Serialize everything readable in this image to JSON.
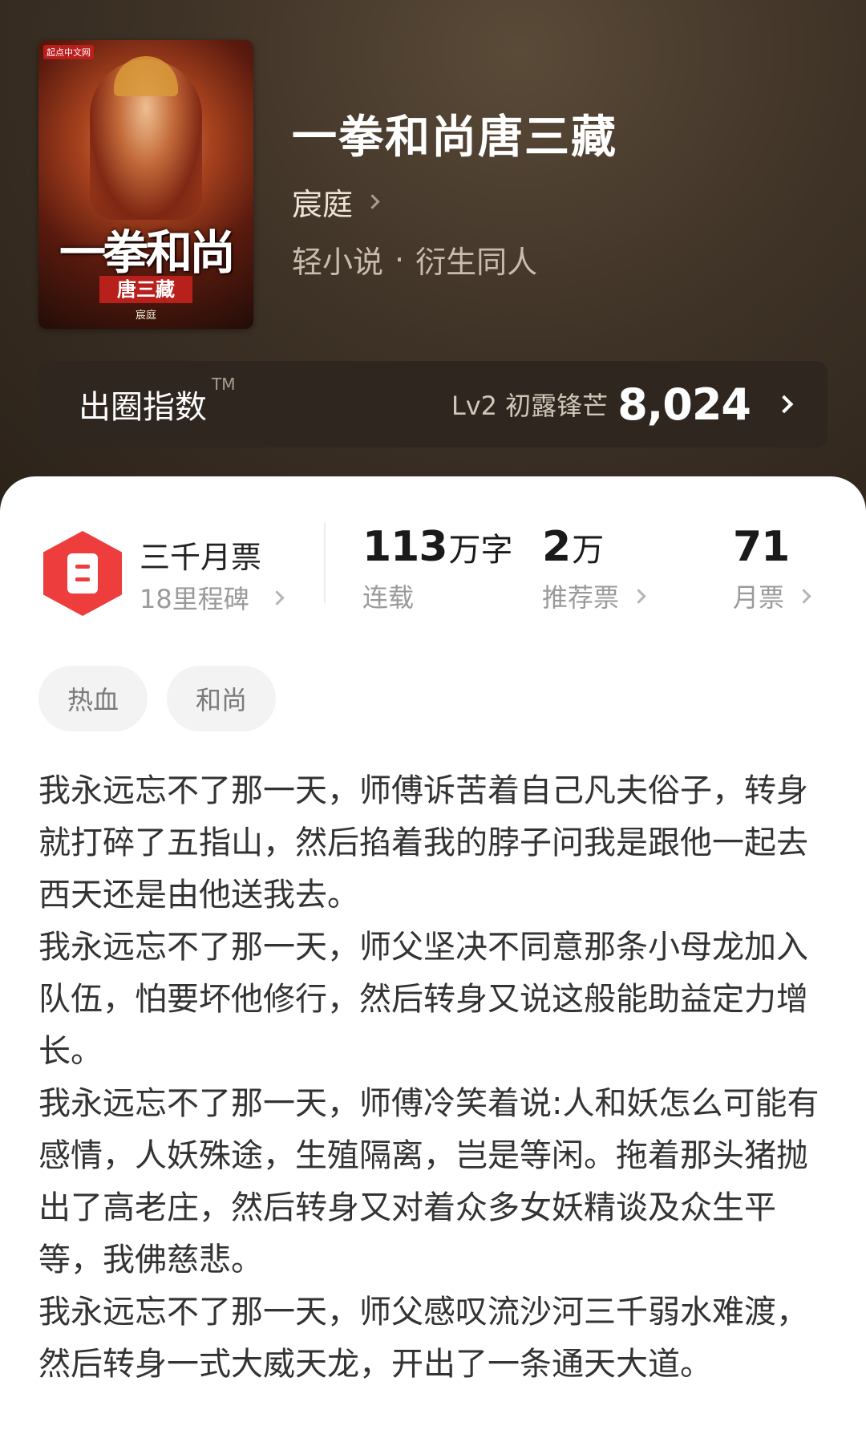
{
  "book": {
    "title": "一拳和尚唐三藏",
    "author": "宸庭",
    "category": "轻小说",
    "dot": "·",
    "subcategory": "衍生同人"
  },
  "cover": {
    "publisher": "起点中文网",
    "title_art": "一拳和尚",
    "subtitle_art": "唐三藏",
    "author_art": "宸庭"
  },
  "index": {
    "label": "出圈指数",
    "tm": "TM",
    "level": "Lv2 初露锋芒",
    "score": "8,024"
  },
  "ranking": {
    "title": "三千月票",
    "milestone": "18里程碑"
  },
  "stats": {
    "words": {
      "num": "113",
      "unit": "万字",
      "label": "连载"
    },
    "recommend": {
      "num": "2",
      "unit": "万",
      "label": "推荐票"
    },
    "monthly": {
      "num": "71",
      "label": "月票"
    }
  },
  "tags": [
    "热血",
    "和尚"
  ],
  "synopsis": [
    "我永远忘不了那一天，师傅诉苦着自己凡夫俗子，转身就打碎了五指山，然后掐着我的脖子问我是跟他一起去西天还是由他送我去。",
    "我永远忘不了那一天，师父坚决不同意那条小母龙加入队伍，怕要坏他修行，然后转身又说这般能助益定力增长。",
    "我永远忘不了那一天，师傅冷笑着说:人和妖怎么可能有感情，人妖殊途，生殖隔离，岂是等闲。拖着那头猪抛出了高老庄，然后转身又对着众多女妖精谈及众生平等，我佛慈悲。",
    "我永远忘不了那一天，师父感叹流沙河三千弱水难渡，然后转身一式大威天龙，开出了一条通天大道。"
  ],
  "colors": {
    "accent": "#ee3d3d",
    "hero_bg": "#3f3327"
  }
}
